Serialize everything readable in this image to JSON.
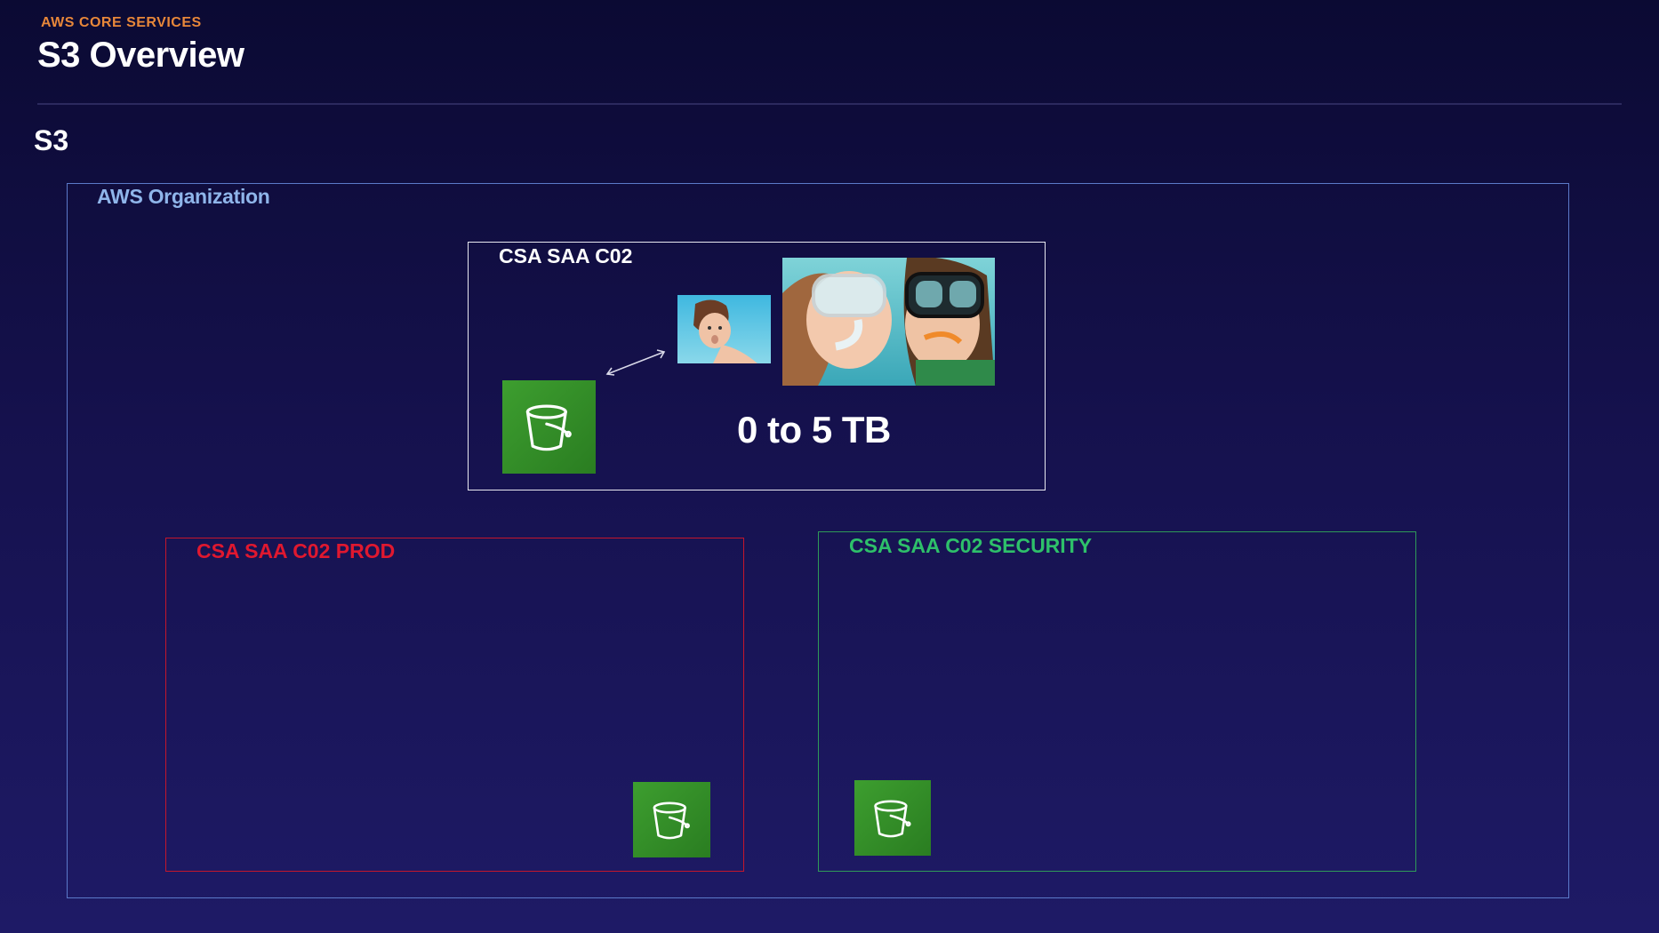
{
  "header": {
    "kicker": "AWS CORE SERVICES",
    "title": "S3 Overview",
    "section": "S3"
  },
  "diagram": {
    "organization_label": "AWS Organization",
    "account_main": {
      "label": "CSA SAA C02",
      "object_size_text": "0 to 5 TB"
    },
    "account_prod": {
      "label": "CSA SAA C02 PROD"
    },
    "account_security": {
      "label": "CSA SAA C02 SECURITY"
    }
  },
  "icons": {
    "bucket": "s3-bucket-icon",
    "arrow": "double-arrow"
  },
  "colors": {
    "kicker": "#e8873a",
    "organization": "#8fb5ea",
    "prod": "#e0182f",
    "security": "#2ec06a",
    "bucket": "#3d9e2f"
  }
}
